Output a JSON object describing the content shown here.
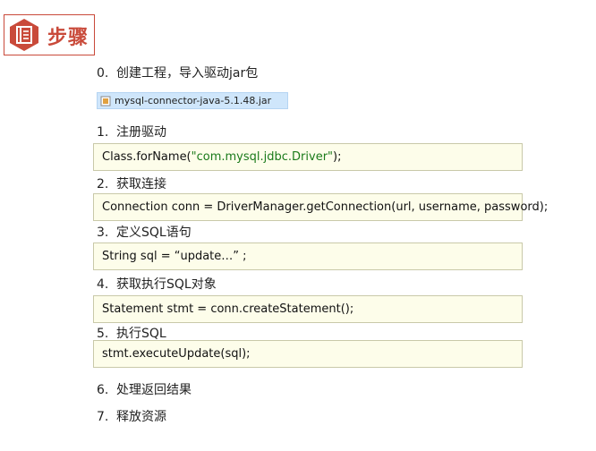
{
  "header": {
    "title": "步骤"
  },
  "steps": [
    {
      "num": "0.",
      "text": "创建工程，导入驱动jar包"
    },
    {
      "num": "1.",
      "text": "注册驱动"
    },
    {
      "num": "2.",
      "text": "获取连接"
    },
    {
      "num": "3.",
      "text": "定义SQL语句"
    },
    {
      "num": "4.",
      "text": "获取执行SQL对象"
    },
    {
      "num": "5.",
      "text": "执行SQL"
    },
    {
      "num": "6.",
      "text": "处理返回结果"
    },
    {
      "num": "7.",
      "text": "释放资源"
    }
  ],
  "jar_file": "mysql-connector-java-5.1.48.jar",
  "code": {
    "register": {
      "pre": "Class.forName(",
      "str": "\"com.mysql.jdbc.Driver\"",
      "post": ");"
    },
    "connection": "Connection conn = DriverManager.getConnection(url, username, password);",
    "sql": "String sql =  “update…” ;",
    "statement": "Statement stmt = conn.createStatement();",
    "execute": "stmt.executeUpdate(sql);"
  },
  "colors": {
    "accent": "#c94a3a",
    "code_bg": "#fdfdea",
    "jar_bg": "#cfe6fb"
  }
}
